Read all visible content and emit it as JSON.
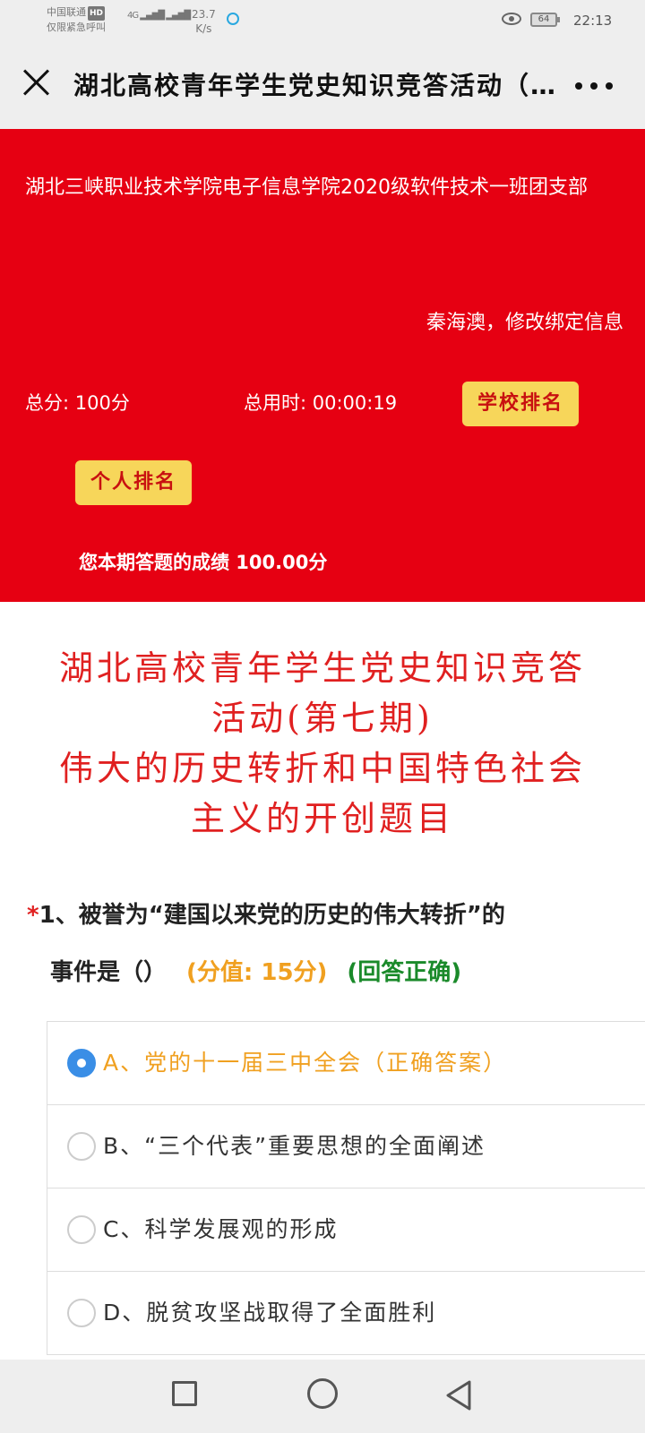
{
  "status_bar": {
    "carrier_line1": "中国联通",
    "carrier_hd": "HD",
    "carrier_line2": "仅限紧急呼叫",
    "signal": "4G",
    "speed_value": "23.7",
    "speed_unit": "K/s",
    "battery": "64",
    "time": "22:13"
  },
  "header": {
    "title": "湖北高校青年学生党史知识竞答活动（第七期）"
  },
  "info": {
    "org": "湖北三峡职业技术学院电子信息学院2020级软件技术一班团支部",
    "user": "秦海澳，修改绑定信息",
    "total_score": "总分: 100分",
    "total_time": "总用时: 00:00:19",
    "school_rank_label": "学校排名",
    "personal_rank_label": "个人排名",
    "result": "您本期答题的成绩 100.00分"
  },
  "quiz": {
    "title_line1": "湖北高校青年学生党史知识竞答",
    "title_line2": "活动(第七期)",
    "title_line3": "伟大的历史转折和中国特色社会",
    "title_line4": "主义的开创题目",
    "question": {
      "required_mark": "*",
      "text_line1": "1、被誉为“建国以来党的历史的伟大转折”的",
      "text_line2": "事件是（）",
      "points": "(分值: 15分)",
      "status": "(回答正确)",
      "options": [
        {
          "label": "A、党的十一届三中全会（正确答案）",
          "checked": true
        },
        {
          "label": "B、“三个代表”重要思想的全面阐述",
          "checked": false
        },
        {
          "label": "C、科学发展观的形成",
          "checked": false
        },
        {
          "label": "D、脱贫攻坚战取得了全面胜利",
          "checked": false
        }
      ]
    }
  },
  "colors": {
    "banner_red": "#e60012",
    "button_yellow": "#f7d65a",
    "title_red": "#e02020",
    "points_orange": "#f0a020",
    "correct_green": "#1a8a2a",
    "radio_blue": "#3a8ee6"
  },
  "icons": {
    "close": "close-icon",
    "more": "more-icon",
    "recent_apps": "square-icon",
    "home": "circle-icon",
    "back": "triangle-back-icon"
  }
}
